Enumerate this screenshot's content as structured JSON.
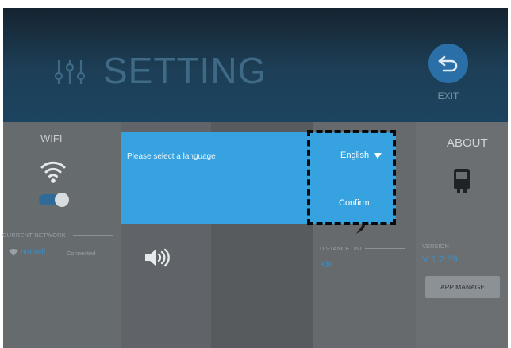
{
  "header": {
    "title": "SETTING",
    "icon": "sliders-icon"
  },
  "exit": {
    "label": "EXIT",
    "icon": "back-arrow-icon"
  },
  "wifi_panel": {
    "title": "WIFI",
    "icon": "wifi-icon",
    "toggle_on": true,
    "current_network_label": "CURRENT NETWORK",
    "network_name": "not wifi",
    "network_status": "Connected"
  },
  "sound_panel": {
    "icon": "speaker-icon"
  },
  "unit_panel": {
    "distance_label": "DISTANCE UNIT",
    "distance_value": "KM"
  },
  "about_panel": {
    "title": "ABOUT",
    "icon": "device-icon",
    "version_label": "VERSION",
    "version_value": "V 1.2.39",
    "app_manage_label": "APP MANAGE"
  },
  "dialog": {
    "prompt": "Please select a language",
    "selected_language": "English",
    "confirm_label": "Confirm"
  },
  "colors": {
    "accent": "#37a2e0",
    "header_bg": "#1d3f57",
    "link": "#3e8ec4"
  }
}
